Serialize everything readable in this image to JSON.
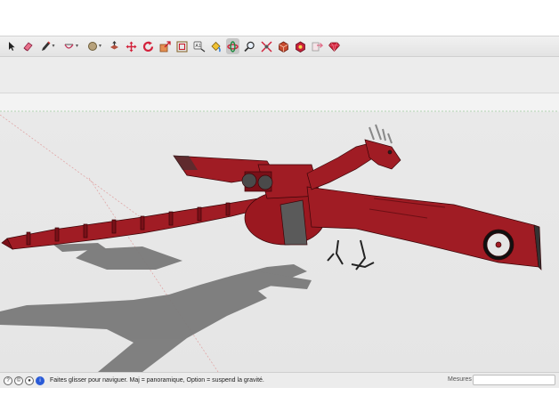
{
  "toolbar": {
    "tools": [
      {
        "name": "select-tool-icon",
        "active": false
      },
      {
        "name": "eraser-tool-icon",
        "active": false
      },
      {
        "name": "pencil-tool-icon",
        "active": false,
        "has_dropdown": true
      },
      {
        "name": "arc-tool-icon",
        "active": false,
        "has_dropdown": true
      },
      {
        "name": "circle-tool-icon",
        "active": false,
        "has_dropdown": true
      },
      {
        "name": "push-pull-tool-icon",
        "active": false
      },
      {
        "name": "move-tool-icon",
        "active": false
      },
      {
        "name": "rotate-tool-icon",
        "active": false
      },
      {
        "name": "scale-tool-icon",
        "active": false
      },
      {
        "name": "offset-tool-icon",
        "active": false
      },
      {
        "name": "tape-measure-tool-icon",
        "active": false
      },
      {
        "name": "text-tool-icon",
        "active": false
      },
      {
        "name": "paint-bucket-tool-icon",
        "active": false
      },
      {
        "name": "orbit-tool-icon",
        "active": true
      },
      {
        "name": "zoom-tool-icon",
        "active": false
      },
      {
        "name": "zoom-extents-tool-icon",
        "active": false
      },
      {
        "name": "warehouse-icon",
        "active": false
      },
      {
        "name": "extension-warehouse-icon",
        "active": false
      },
      {
        "name": "send-to-layout-icon",
        "active": false
      },
      {
        "name": "ruby-console-icon",
        "active": false
      }
    ]
  },
  "viewport": {
    "model_color": "#a01c24",
    "model_dark": "#6d0f15",
    "shadow_color": "#767676"
  },
  "statusbar": {
    "hint_text": "Faites glisser pour naviguer. Maj = panoramique, Option =  suspend la gravité.",
    "measure_label": "Mesures",
    "measure_value": ""
  }
}
